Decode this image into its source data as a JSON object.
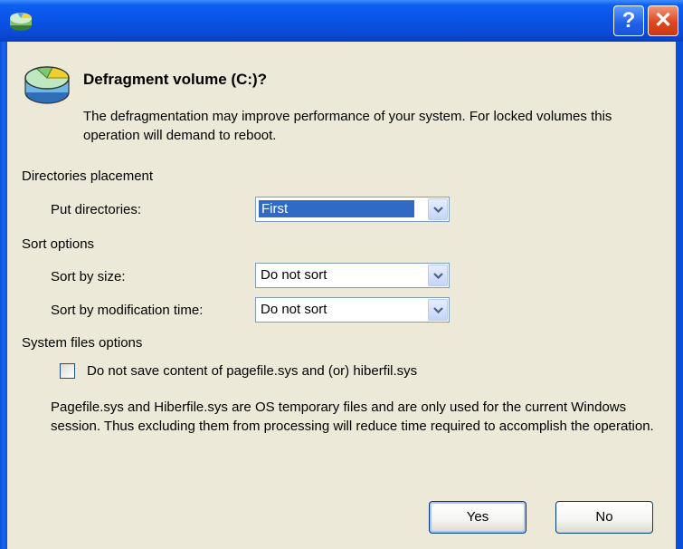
{
  "window": {
    "title": "",
    "help_button": "?",
    "close_button": "✕"
  },
  "header": {
    "question": "Defragment volume (C:)?",
    "description": "The defragmentation may improve performance of your system. For locked volumes this operation will demand to reboot."
  },
  "directories": {
    "group_label": "Directories placement",
    "put_label": "Put directories:",
    "put_value": "First"
  },
  "sort": {
    "group_label": "Sort options",
    "size_label": "Sort by size:",
    "size_value": "Do not sort",
    "time_label": "Sort by modification time:",
    "time_value": "Do not sort"
  },
  "system_files": {
    "group_label": "System files options",
    "checkbox_label": "Do not save content of pagefile.sys and (or) hiberfil.sys",
    "checked": false,
    "note": "Pagefile.sys and Hiberfile.sys are OS temporary files and are only used for the current Windows session. Thus excluding them from processing will reduce time required to accomplish the operation."
  },
  "buttons": {
    "yes": "Yes",
    "no": "No"
  },
  "colors": {
    "titlebar": "#0a54e8",
    "client_background": "#ece9d8",
    "selection": "#316ac5",
    "close_button": "#e0451f"
  },
  "icons": {
    "title": "app-disk-icon",
    "header": "disk-volume-icon",
    "dropdown": "chevron-down-icon"
  }
}
